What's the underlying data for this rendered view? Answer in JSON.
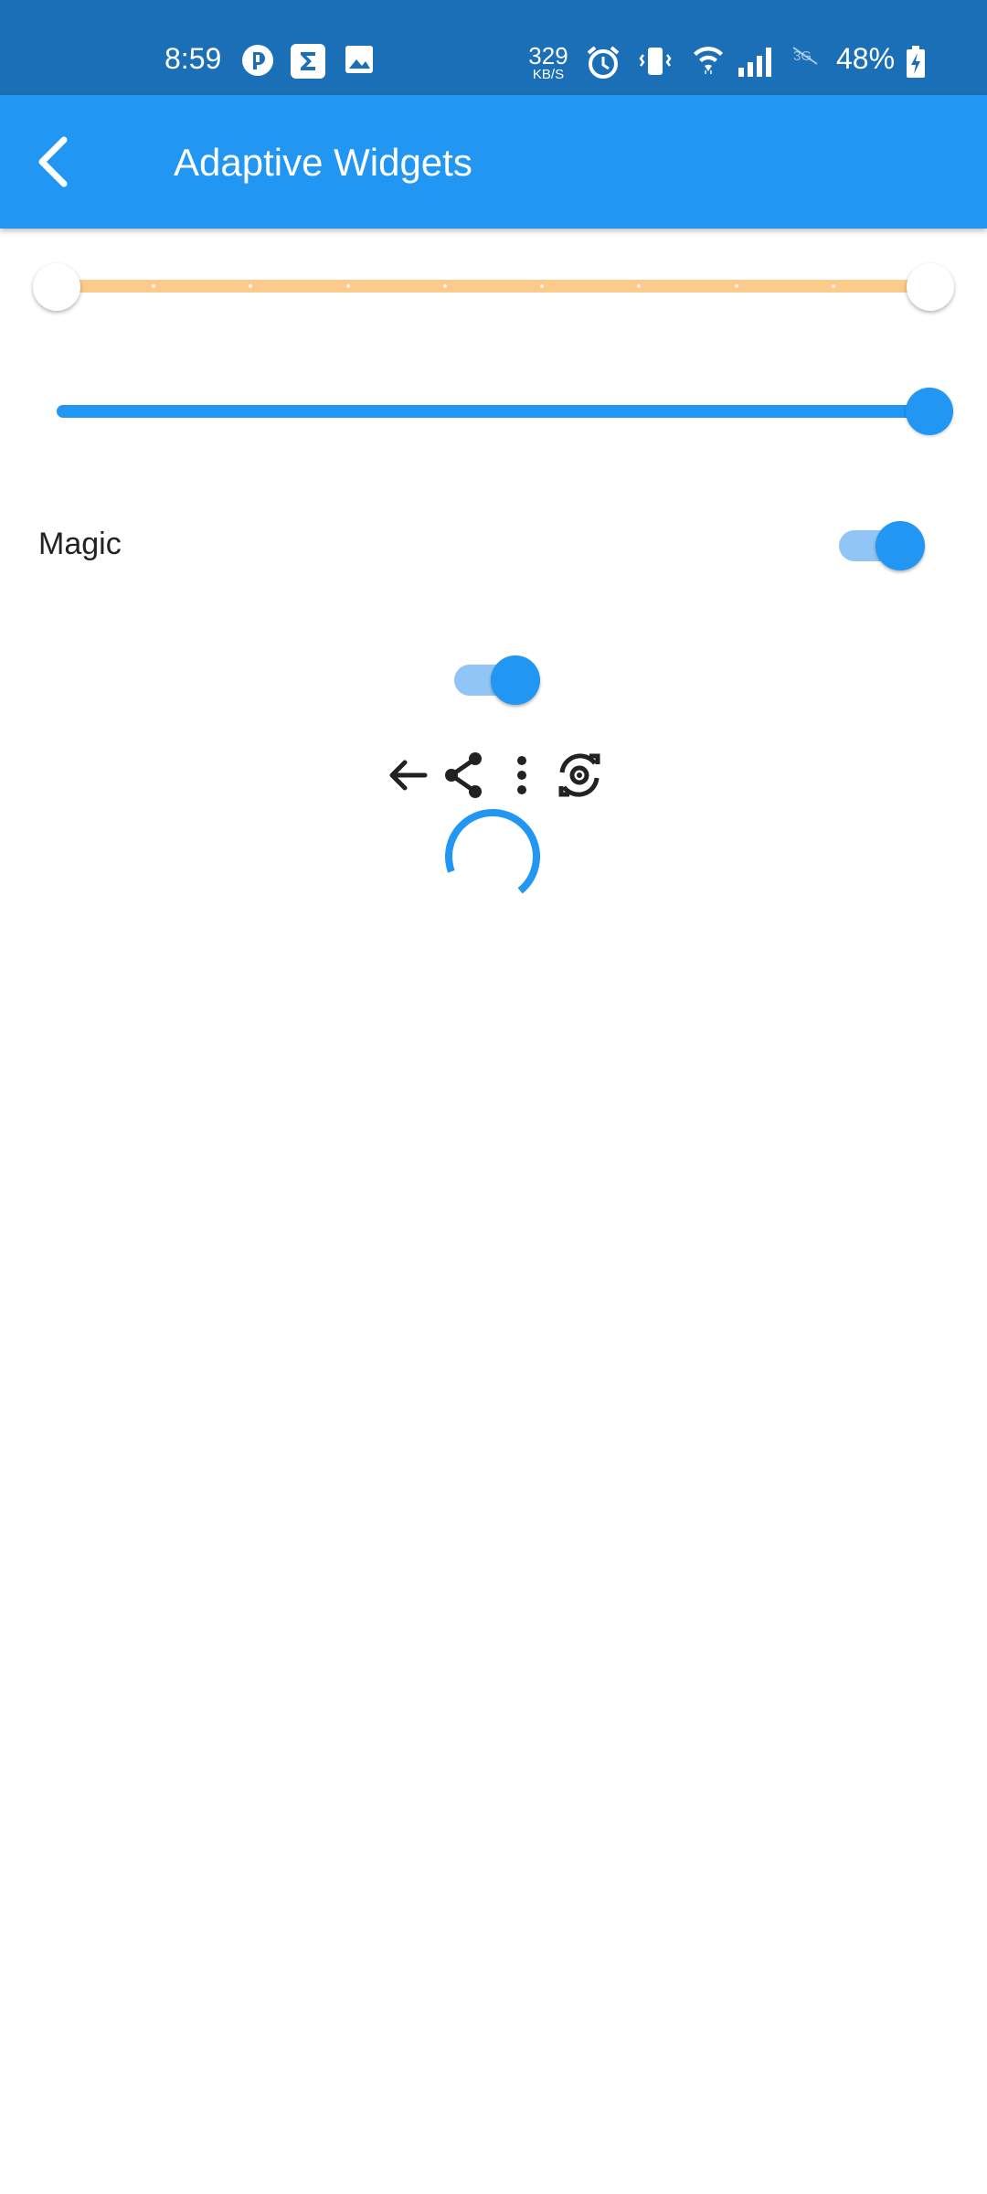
{
  "status_bar": {
    "time": "8:59",
    "network_speed_value": "329",
    "network_speed_unit": "KB/S",
    "battery_percent": "48%",
    "icons": [
      "app-notification-icon",
      "sigma-icon",
      "image-icon",
      "alarm-icon",
      "vibrate-icon",
      "wifi-icon",
      "signal-icon",
      "no-3g-icon",
      "battery-charging-icon"
    ]
  },
  "app_bar": {
    "title": "Adaptive Widgets",
    "back_icon": "chevron-left-icon"
  },
  "range_slider": {
    "start": 0.0,
    "end": 1.0,
    "divisions": 9,
    "color": "#fccb8b"
  },
  "slider": {
    "value": 1.0,
    "color": "#2196f3"
  },
  "magic_switch": {
    "label": "Magic",
    "on": true
  },
  "standalone_switch": {
    "on": true
  },
  "icon_row": [
    "arrow-back-icon",
    "share-icon",
    "more-vert-icon",
    "flip-camera-icon"
  ],
  "colors": {
    "primary": "#2196f3",
    "status_bar": "#1b6fb6",
    "range_track": "#fccb8b"
  }
}
